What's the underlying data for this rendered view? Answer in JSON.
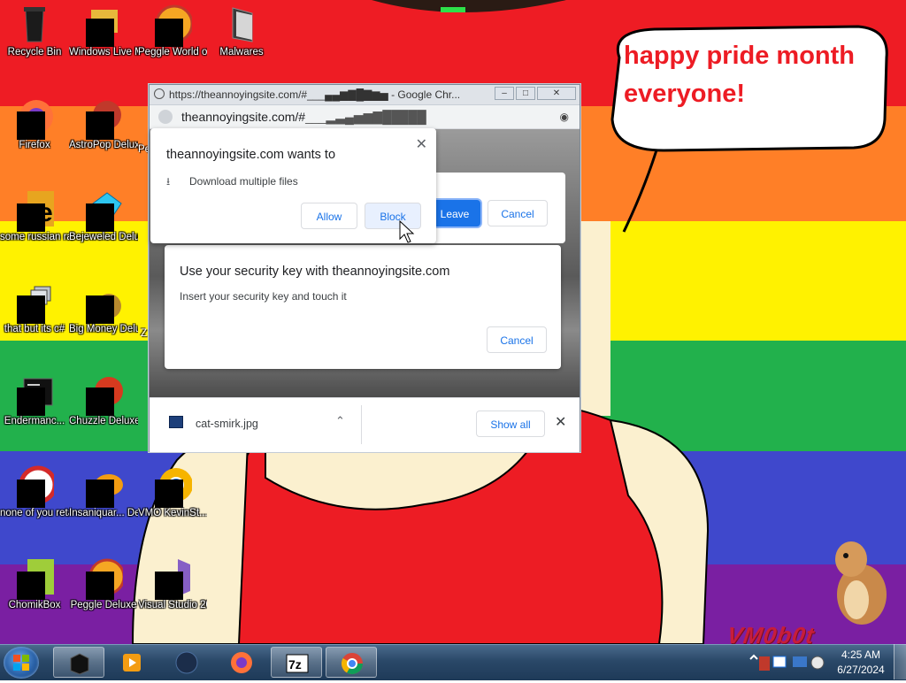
{
  "desktop": {
    "speech_text": "happy pride month everyone!",
    "watermark": "VM0b0t",
    "icons": [
      {
        "name": "recycle-bin",
        "label": "Recycle Bin"
      },
      {
        "name": "windows-live-mail",
        "label": "Windows Live Mail"
      },
      {
        "name": "peggle-world-of-warcraft",
        "label": "Peggle World of Warcraft ..."
      },
      {
        "name": "malwares",
        "label": "Malwares"
      },
      {
        "name": "firefox",
        "label": "Firefox"
      },
      {
        "name": "astropop-deluxe",
        "label": "AstroPop Deluxe"
      },
      {
        "name": "some-russian-ran-a-rat",
        "label": "some russian ran a rat"
      },
      {
        "name": "bejeweled-deluxe",
        "label": "Bejeweled Deluxe"
      },
      {
        "name": "that-but-its-csharp",
        "label": "that but its c#"
      },
      {
        "name": "big-money-deluxe",
        "label": "Big Money Deluxe"
      },
      {
        "name": "endermanch",
        "label": "Endermanc..."
      },
      {
        "name": "chuzzle-deluxe",
        "label": "Chuzzle Deluxe"
      },
      {
        "name": "none-of-you",
        "label": "none of you retards kno..."
      },
      {
        "name": "insaniquarium-deluxe",
        "label": "Insaniquar... Deluxe"
      },
      {
        "name": "vmo-kevinst",
        "label": "VMO KevinSt..."
      },
      {
        "name": "chomikbox",
        "label": "ChomikBox"
      },
      {
        "name": "peggle-deluxe",
        "label": "Peggle Deluxe"
      },
      {
        "name": "visual-studio-2015",
        "label": "Visual Studio 2015"
      }
    ],
    "partial_labels": {
      "pe": "Pe",
      "z": "Z"
    }
  },
  "chrome": {
    "title": "https://theannoyingsite.com/#___▄▄▆▇█▇▆▅ - Google Chr...",
    "url_host": "theannoyingsite.com/#",
    "url_tail": "___▂▃▄▅▆▇█████",
    "permission_prompt": {
      "title": "theannoyingsite.com wants to",
      "item": "Download multiple files",
      "allow": "Allow",
      "block": "Block"
    },
    "leave_dialog": {
      "leave": "Leave",
      "cancel": "Cancel"
    },
    "security_dialog": {
      "title": "Use your security key with theannoyingsite.com",
      "body": "Insert your security key and touch it",
      "cancel": "Cancel"
    },
    "download_bar": {
      "file": "cat-smirk.jpg",
      "show_all": "Show all"
    }
  },
  "taskbar": {
    "time": "4:25 AM",
    "date": "6/27/2024",
    "items": [
      "start",
      "black-app",
      "media-player",
      "dark-globe",
      "firefox",
      "7zip",
      "chrome"
    ]
  },
  "colors": {
    "speech_text": "#ed1c24",
    "chrome_blue": "#1a73e8",
    "rainbow": [
      "#ee1c24",
      "#ff7f27",
      "#fff200",
      "#22b14c",
      "#3f48cc",
      "#7a1fa2"
    ]
  }
}
